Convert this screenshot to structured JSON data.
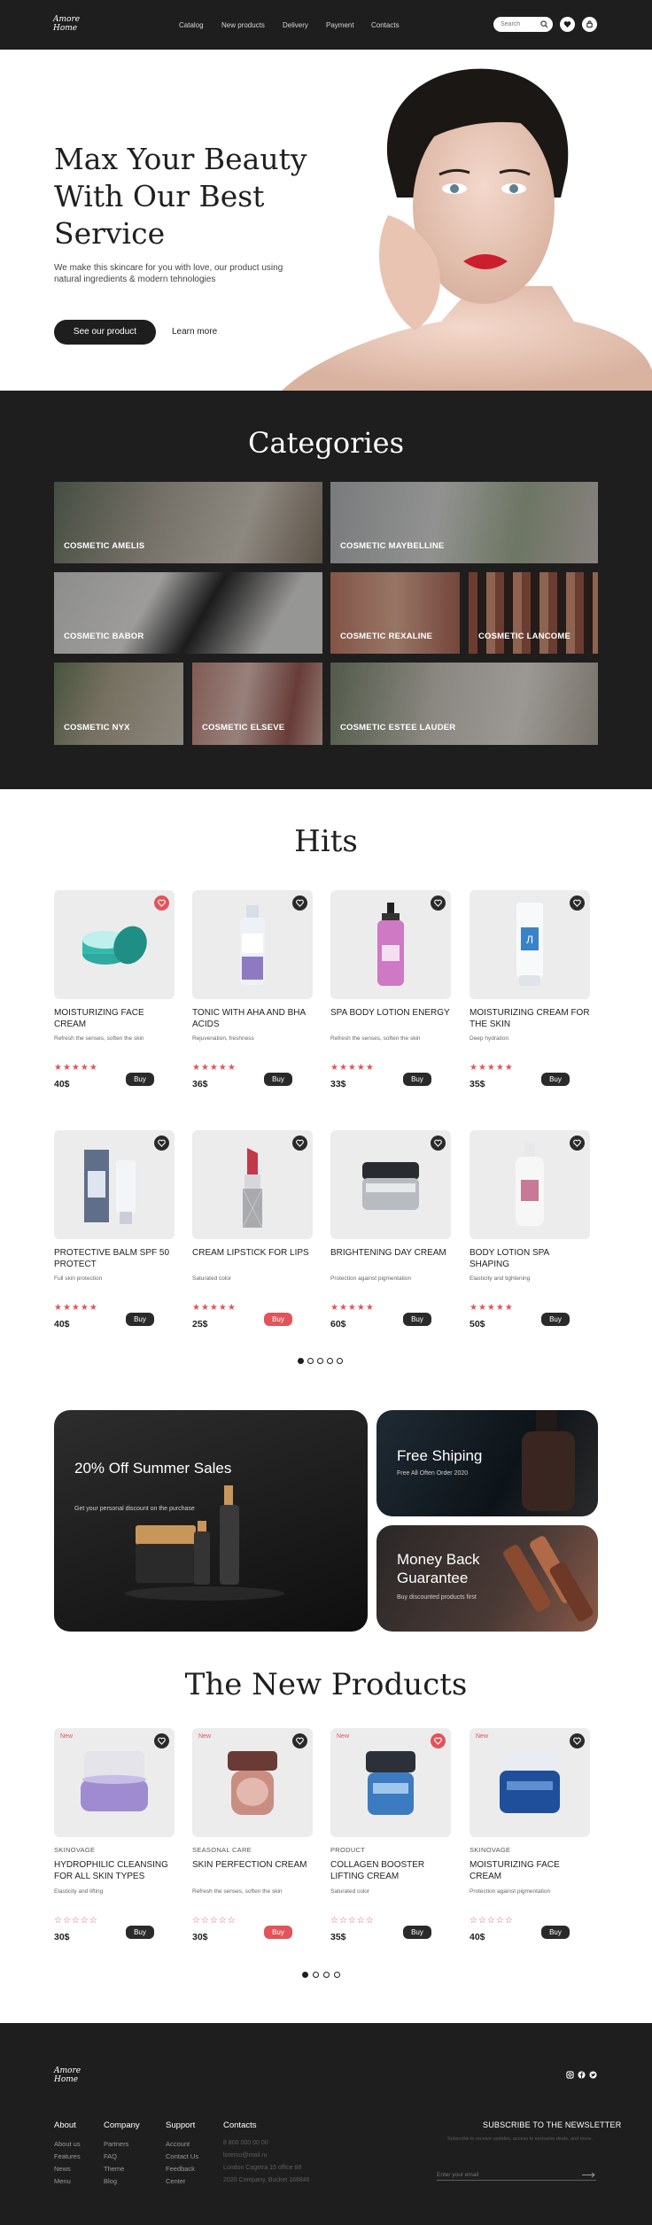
{
  "header": {
    "logo": "Amore Home",
    "nav": [
      "Catalog",
      "New products",
      "Delivery",
      "Payment",
      "Contacts"
    ],
    "search_placeholder": "Search",
    "icons": [
      "search-icon",
      "heart-icon",
      "cart-icon"
    ]
  },
  "hero": {
    "title": "Max Your Beauty With Our Best Service",
    "subtitle": "We make this skincare for you with love, our product using natural ingredients & modern tehnologies",
    "cta": "See our product",
    "learn_more": "Learn more"
  },
  "categories": {
    "title": "Categories",
    "items": [
      "COSMETIC AMELIS",
      "COSMETIC MAYBELLINE",
      "COSMETIC BABOR",
      "COSMETIC REXALINE",
      "COSMETIC LANCOME",
      "COSMETIC NYX",
      "COSMETIC ELSEVE",
      "COSMETIC ESTEE LAUDER"
    ]
  },
  "hits": {
    "title": "Hits",
    "products": [
      {
        "name": "MOISTURIZING FACE CREAM",
        "desc": "Refresh the senses, soften the skin",
        "stars": "★★★★★",
        "price": "40$",
        "buy": "Buy"
      },
      {
        "name": "TONIC WITH AHA AND BHA ACIDS",
        "desc": "Rejuvenation, freshness",
        "stars": "★★★★★",
        "price": "36$",
        "buy": "Buy"
      },
      {
        "name": "SPA BODY LOTION ENERGY",
        "desc": "Refresh the senses, soften the skin",
        "stars": "★★★★★",
        "price": "33$",
        "buy": "Buy"
      },
      {
        "name": "MOISTURIZING CREAM FOR THE SKIN",
        "desc": "Deep hydration",
        "stars": "★★★★★",
        "price": "35$",
        "buy": "Buy"
      },
      {
        "name": "PROTECTIVE BALM SPF 50 PROTECT",
        "desc": "Full skin protection",
        "stars": "★★★★★",
        "price": "40$",
        "buy": "Buy"
      },
      {
        "name": "CREAM LIPSTICK FOR LIPS",
        "desc": "Saturated color",
        "stars": "★★★★★",
        "price": "25$",
        "buy": "Buy"
      },
      {
        "name": "BRIGHTENING DAY CREAM",
        "desc": "Protection against pigmentation",
        "stars": "★★★★★",
        "price": "60$",
        "buy": "Buy"
      },
      {
        "name": "BODY LOTION SPA SHAPING",
        "desc": "Elasticity and tightening",
        "stars": "★★★★★",
        "price": "50$",
        "buy": "Buy"
      }
    ]
  },
  "promos": {
    "sale_title": "20% Off Summer Sales",
    "sale_sub": "Get your personal discount on the purchase",
    "shipping_title": "Free Shiping",
    "shipping_sub": "Free All Often Order 2020",
    "money_title": "Money Back Guarantee",
    "money_sub": "Buy discounted products first"
  },
  "new_products": {
    "title": "The New Products",
    "tag": "New",
    "products": [
      {
        "brand": "SKINOVAGE",
        "name": "HYDROPHILIC CLEANSING FOR ALL SKIN TYPES",
        "desc": "Elasticity and lifting",
        "stars": "☆☆☆☆☆",
        "price": "30$",
        "buy": "Buy"
      },
      {
        "brand": "SEASONAL CARE",
        "name": "SKIN PERFECTION CREAM",
        "desc": "Refresh the senses, soften the skin",
        "stars": "☆☆☆☆☆",
        "price": "30$",
        "buy": "Buy"
      },
      {
        "brand": "PRODUCT",
        "name": "COLLAGEN BOOSTER LIFTING CREAM",
        "desc": "Saturated color",
        "stars": "☆☆☆☆☆",
        "price": "35$",
        "buy": "Buy"
      },
      {
        "brand": "SKINOVAGE",
        "name": "MOISTURIZING FACE CREAM",
        "desc": "Protection against pigmentation",
        "stars": "☆☆☆☆☆",
        "price": "40$",
        "buy": "Buy"
      }
    ]
  },
  "footer": {
    "logo": "Amore Home",
    "about": {
      "title": "About",
      "links": [
        "About us",
        "Features",
        "News",
        "Menu"
      ]
    },
    "company": {
      "title": "Company",
      "links": [
        "Partners",
        "FAQ",
        "Theme",
        "Blog"
      ]
    },
    "support": {
      "title": "Support",
      "links": [
        "Account",
        "Contact Us",
        "Feedback",
        "Center"
      ]
    },
    "contacts": {
      "title": "Contacts",
      "lines": [
        "8 800 000 00 00",
        "loremo@mail.ru",
        "London Cagetra 15 office 88",
        "2020 Company, Bucket 168846"
      ]
    },
    "newsletter": {
      "title": "SUBSCRIBE TO THE NEWSLETTER",
      "text": "Subscribe to receive updates, access to exclusive deals, and more.",
      "placeholder": "Enter your email"
    }
  },
  "colors": {
    "dark": "#1e1e1e",
    "accent": "#e2535a",
    "card": "#ececec"
  }
}
